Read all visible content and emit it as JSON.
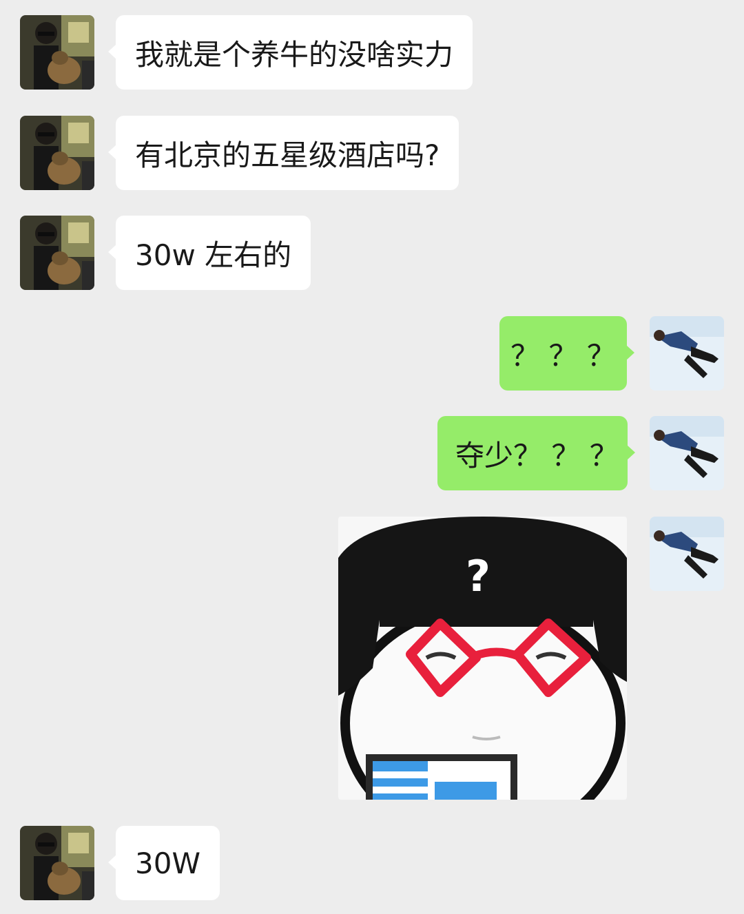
{
  "chat": {
    "messages": [
      {
        "side": "left",
        "sender": "friend",
        "text": "我就是个养牛的没啥实力"
      },
      {
        "side": "left",
        "sender": "friend",
        "text": "有北京的五星级酒店吗?"
      },
      {
        "side": "left",
        "sender": "friend",
        "text": "30w 左右的"
      },
      {
        "side": "right",
        "sender": "me",
        "text": "？ ？ ？"
      },
      {
        "side": "right",
        "sender": "me",
        "text": "夺少？ ？ ？"
      },
      {
        "side": "right",
        "sender": "me",
        "type": "sticker",
        "sticker_text": "?"
      },
      {
        "side": "left",
        "sender": "friend",
        "text": "30W"
      }
    ]
  },
  "colors": {
    "background": "#ededed",
    "incoming_bubble": "#ffffff",
    "outgoing_bubble": "#95ec69",
    "sticker_glasses": "#e8203c"
  },
  "icons": {
    "friend_avatar": "person-with-dog-photo-avatar",
    "my_avatar": "person-lying-in-snow-photo-avatar"
  }
}
